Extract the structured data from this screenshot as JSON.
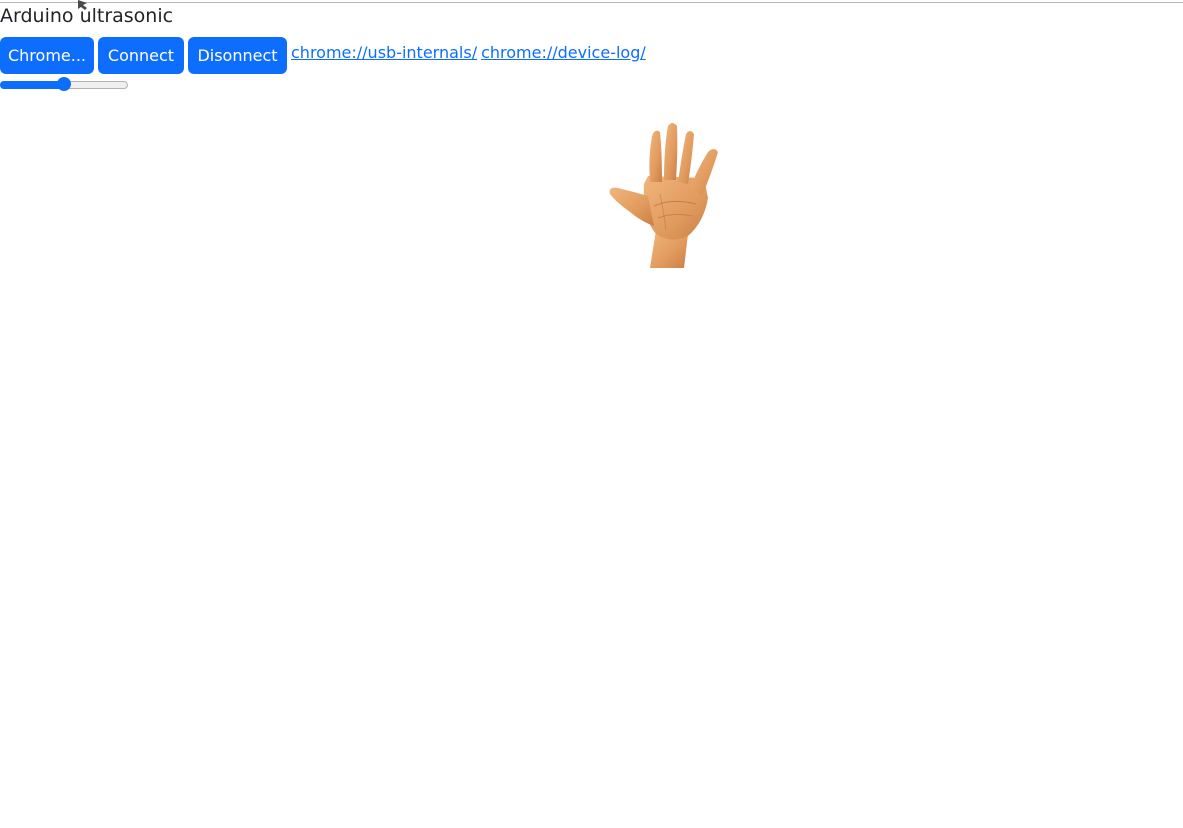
{
  "page": {
    "title": "Arduino ultrasonic"
  },
  "toolbar": {
    "buttons": [
      {
        "label": "Chrome..."
      },
      {
        "label": "Connect"
      },
      {
        "label": "Disonnect"
      }
    ],
    "links": [
      {
        "text": "chrome://usb-internals/"
      },
      {
        "text": "chrome://device-log/"
      }
    ]
  },
  "slider": {
    "value_fraction": 0.5
  },
  "image": {
    "icon": "raised-hand-photo"
  },
  "colors": {
    "accent": "#0d6efd",
    "text": "#212529",
    "skin": "#e8a266"
  }
}
